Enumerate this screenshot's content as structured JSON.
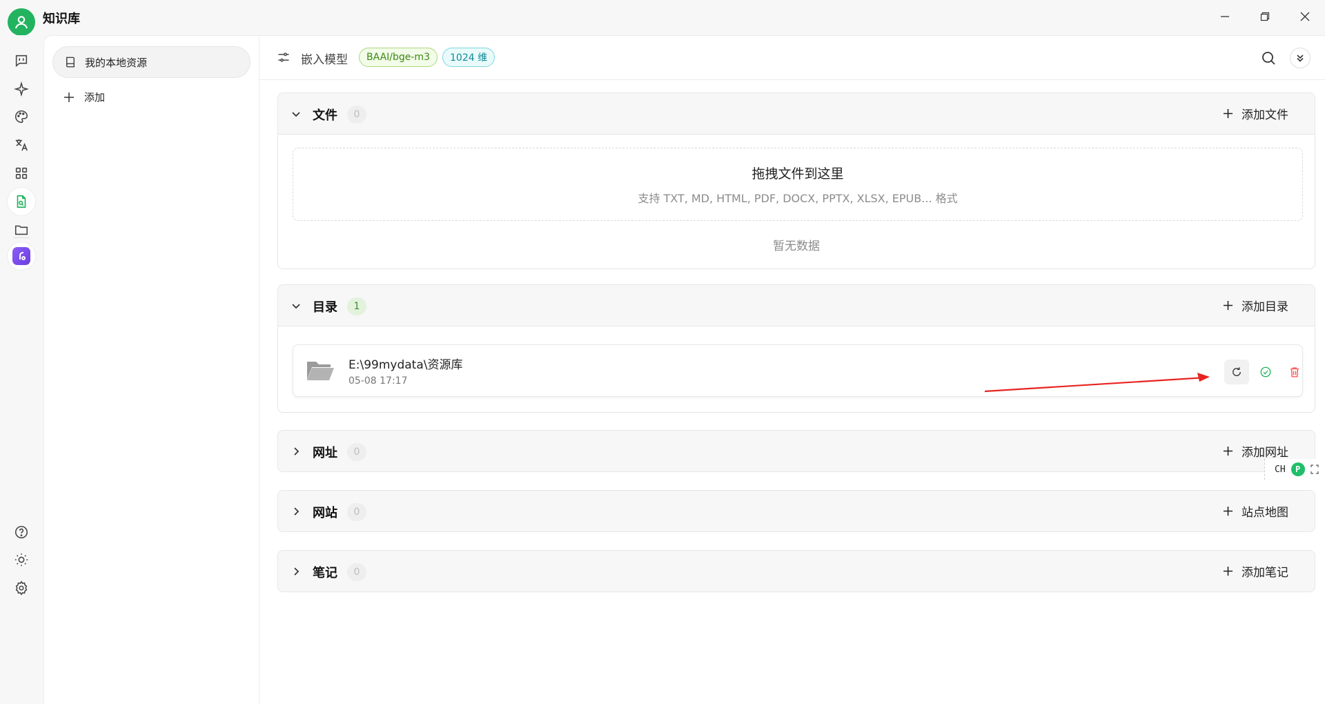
{
  "app": {
    "title": "知识库"
  },
  "knowledge_bases": {
    "items": [
      {
        "label": "我的本地资源"
      }
    ],
    "add_label": "添加"
  },
  "header": {
    "embed_label": "嵌入模型",
    "model_tag": "BAAI/bge-m3",
    "dim_tag": "1024 维"
  },
  "sections": {
    "files": {
      "title": "文件",
      "count": "0",
      "action": "添加文件",
      "dropzone_title": "拖拽文件到这里",
      "dropzone_sub": "支持 TXT, MD, HTML, PDF, DOCX, PPTX, XLSX, EPUB... 格式",
      "empty": "暂无数据"
    },
    "directories": {
      "title": "目录",
      "count": "1",
      "action": "添加目录",
      "items": [
        {
          "path": "E:\\99mydata\\资源库",
          "time": "05-08 17:17"
        }
      ]
    },
    "urls": {
      "title": "网址",
      "count": "0",
      "action": "添加网址"
    },
    "websites": {
      "title": "网站",
      "count": "0",
      "action": "站点地图"
    },
    "notes": {
      "title": "笔记",
      "count": "0",
      "action": "添加笔记"
    }
  },
  "ime": {
    "label": "CH",
    "badge": "P"
  },
  "colors": {
    "accent": "#22b35e",
    "danger": "#ff4d4f",
    "annotation": "#e8231f"
  }
}
